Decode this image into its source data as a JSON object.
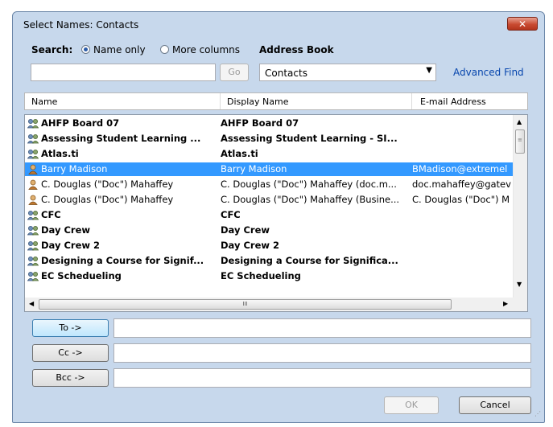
{
  "window": {
    "title": "Select Names: Contacts",
    "close_glyph": "✕"
  },
  "search": {
    "label": "Search:",
    "option_name_only": "Name only",
    "option_more_columns": "More columns",
    "selected": "Name only",
    "input_value": "",
    "go_label": "Go"
  },
  "address_book": {
    "label": "Address Book",
    "selected": "Contacts",
    "advanced_find": "Advanced Find"
  },
  "columns": [
    "Name",
    "Display Name",
    "E-mail Address"
  ],
  "rows": [
    {
      "type": "group",
      "name": "AHFP Board 07",
      "display": "AHFP Board 07",
      "email": ""
    },
    {
      "type": "group",
      "name": "Assessing Student Learning ...",
      "display": "Assessing Student Learning - SI...",
      "email": ""
    },
    {
      "type": "group",
      "name": "Atlas.ti",
      "display": "Atlas.ti",
      "email": ""
    },
    {
      "type": "contact",
      "name": "Barry Madison",
      "display": "Barry Madison",
      "email": "BMadison@extremel",
      "selected": true
    },
    {
      "type": "contact",
      "name": "C. Douglas (\"Doc\") Mahaffey",
      "display": "C. Douglas (\"Doc\") Mahaffey (doc.m...",
      "email": "doc.mahaffey@gatev"
    },
    {
      "type": "contact",
      "name": "C. Douglas (\"Doc\") Mahaffey",
      "display": "C. Douglas (\"Doc\") Mahaffey (Busine...",
      "email": "C. Douglas (\"Doc\") M"
    },
    {
      "type": "group",
      "name": "CFC",
      "display": "CFC",
      "email": ""
    },
    {
      "type": "group",
      "name": "Day Crew",
      "display": "Day Crew",
      "email": ""
    },
    {
      "type": "group",
      "name": "Day Crew 2",
      "display": "Day Crew 2",
      "email": ""
    },
    {
      "type": "group",
      "name": "Designing a Course for Signif...",
      "display": "Designing a Course for Significa...",
      "email": ""
    },
    {
      "type": "group",
      "name": "EC Schedueling",
      "display": "EC Schedueling",
      "email": ""
    }
  ],
  "scroll": {
    "hthumb_label": "III"
  },
  "recipients": {
    "to_label": "To ->",
    "to_value": "",
    "cc_label": "Cc ->",
    "cc_value": "",
    "bcc_label": "Bcc ->",
    "bcc_value": ""
  },
  "buttons": {
    "ok": "OK",
    "cancel": "Cancel"
  },
  "colors": {
    "selection": "#3399ff",
    "link": "#0645ad",
    "close": "#c94b32"
  }
}
